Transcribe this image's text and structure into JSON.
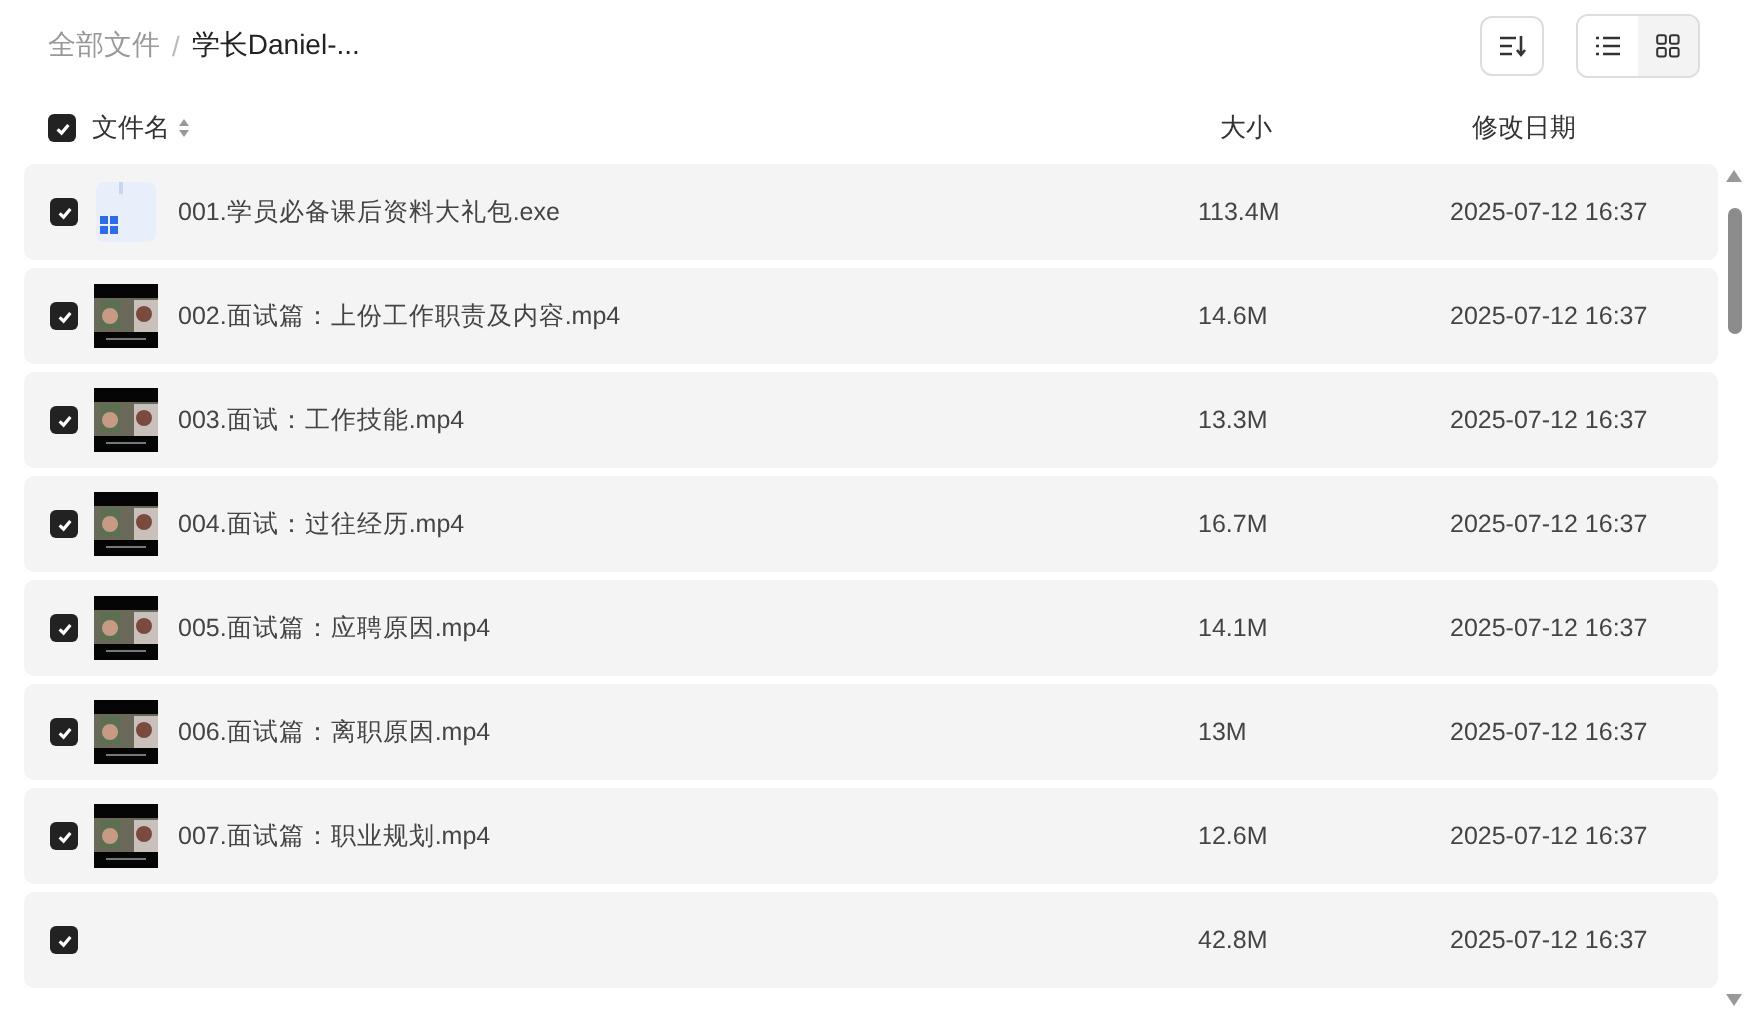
{
  "breadcrumb": [
    {
      "label": "全部文件",
      "current": false
    },
    {
      "label": "学长Daniel-...",
      "current": true
    }
  ],
  "breadcrumb_separator": "/",
  "view_toggle": [
    {
      "kind": "list",
      "selected": true
    },
    {
      "kind": "grid",
      "selected": false
    }
  ],
  "header": {
    "checked": true,
    "name": "文件名",
    "size": "大小",
    "date": "修改日期"
  },
  "rows": [
    {
      "checked": true,
      "kind": "exe",
      "name": "001.学员必备课后资料大礼包.exe",
      "size": "113.4M",
      "date": "2025-07-12 16:37"
    },
    {
      "checked": true,
      "kind": "video",
      "name": "002.面试篇：上份工作职责及内容.mp4",
      "size": "14.6M",
      "date": "2025-07-12 16:37"
    },
    {
      "checked": true,
      "kind": "video",
      "name": "003.面试：工作技能.mp4",
      "size": "13.3M",
      "date": "2025-07-12 16:37"
    },
    {
      "checked": true,
      "kind": "video",
      "name": "004.面试：过往经历.mp4",
      "size": "16.7M",
      "date": "2025-07-12 16:37"
    },
    {
      "checked": true,
      "kind": "video",
      "name": "005.面试篇：应聘原因.mp4",
      "size": "14.1M",
      "date": "2025-07-12 16:37"
    },
    {
      "checked": true,
      "kind": "video",
      "name": "006.面试篇：离职原因.mp4",
      "size": "13M",
      "date": "2025-07-12 16:37"
    },
    {
      "checked": true,
      "kind": "video",
      "name": "007.面试篇：职业规划.mp4",
      "size": "12.6M",
      "date": "2025-07-12 16:37"
    },
    {
      "checked": true,
      "size": "42.8M",
      "date": "2025-07-12 16:37"
    }
  ]
}
